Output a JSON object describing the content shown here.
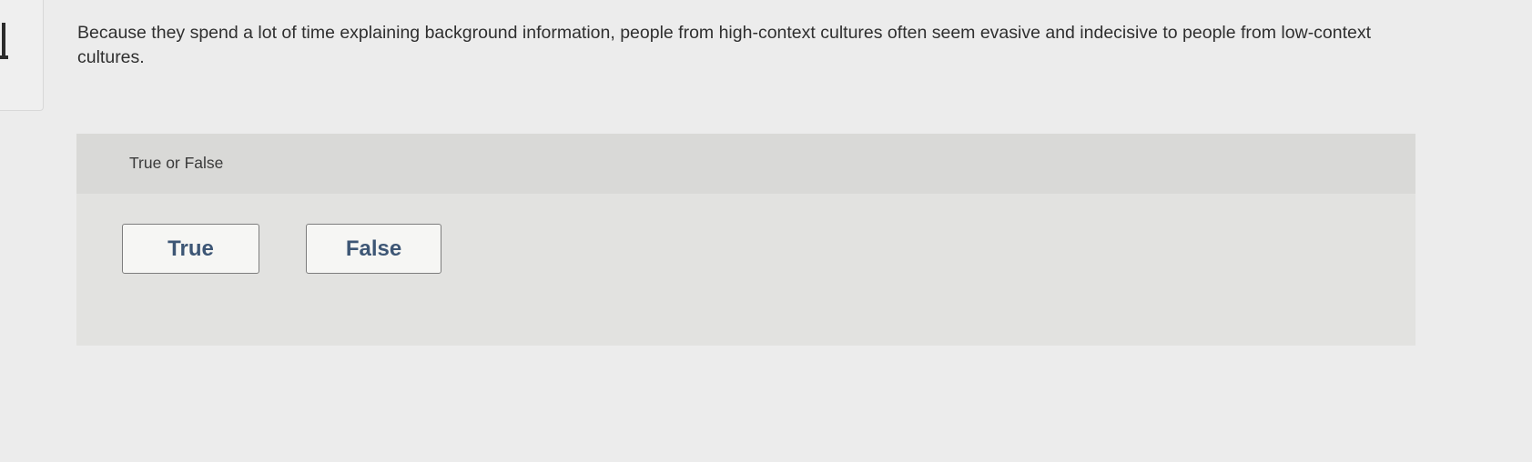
{
  "question": {
    "text": "Because they spend a lot of time explaining background information, people from high-context cultures often seem evasive and indecisive to people from low-context cultures."
  },
  "answer_panel": {
    "header_label": "True or False",
    "choices": [
      {
        "label": "True"
      },
      {
        "label": "False"
      }
    ]
  },
  "colors": {
    "page_background": "#ececec",
    "panel_background": "#e2e2e0",
    "panel_header_background": "#d9d9d7",
    "button_text": "#3d5675",
    "button_border": "#7d7d7d"
  }
}
